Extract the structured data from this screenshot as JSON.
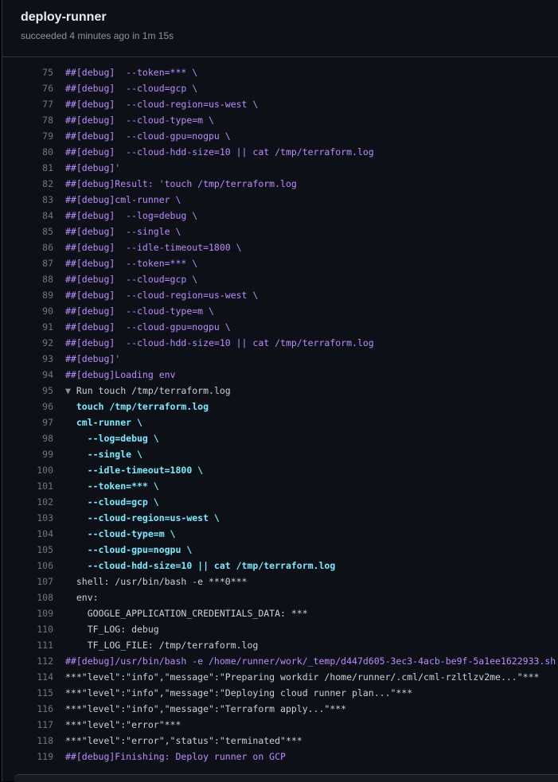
{
  "header": {
    "title": "deploy-runner",
    "subtitle": "succeeded 4 minutes ago in 1m 15s"
  },
  "log_lines": [
    {
      "n": "75",
      "text": "##[debug]  --token=*** \\",
      "kind": "debug"
    },
    {
      "n": "76",
      "text": "##[debug]  --cloud=gcp \\",
      "kind": "debug"
    },
    {
      "n": "77",
      "text": "##[debug]  --cloud-region=us-west \\",
      "kind": "debug"
    },
    {
      "n": "78",
      "text": "##[debug]  --cloud-type=m \\",
      "kind": "debug"
    },
    {
      "n": "79",
      "text": "##[debug]  --cloud-gpu=nogpu \\",
      "kind": "debug"
    },
    {
      "n": "80",
      "text": "##[debug]  --cloud-hdd-size=10 || cat /tmp/terraform.log",
      "kind": "debug"
    },
    {
      "n": "81",
      "text": "##[debug]'",
      "kind": "debug"
    },
    {
      "n": "82",
      "text": "##[debug]Result: 'touch /tmp/terraform.log",
      "kind": "debug"
    },
    {
      "n": "83",
      "text": "##[debug]cml-runner \\",
      "kind": "debug"
    },
    {
      "n": "84",
      "text": "##[debug]  --log=debug \\",
      "kind": "debug"
    },
    {
      "n": "85",
      "text": "##[debug]  --single \\",
      "kind": "debug"
    },
    {
      "n": "86",
      "text": "##[debug]  --idle-timeout=1800 \\",
      "kind": "debug"
    },
    {
      "n": "87",
      "text": "##[debug]  --token=*** \\",
      "kind": "debug"
    },
    {
      "n": "88",
      "text": "##[debug]  --cloud=gcp \\",
      "kind": "debug"
    },
    {
      "n": "89",
      "text": "##[debug]  --cloud-region=us-west \\",
      "kind": "debug"
    },
    {
      "n": "90",
      "text": "##[debug]  --cloud-type=m \\",
      "kind": "debug"
    },
    {
      "n": "91",
      "text": "##[debug]  --cloud-gpu=nogpu \\",
      "kind": "debug"
    },
    {
      "n": "92",
      "text": "##[debug]  --cloud-hdd-size=10 || cat /tmp/terraform.log",
      "kind": "debug"
    },
    {
      "n": "93",
      "text": "##[debug]'",
      "kind": "debug"
    },
    {
      "n": "94",
      "text": "##[debug]Loading env",
      "kind": "debug"
    },
    {
      "n": "95",
      "text": "Run touch /tmp/terraform.log",
      "kind": "group",
      "caret": "▼"
    },
    {
      "n": "96",
      "text": "  touch /tmp/terraform.log",
      "kind": "cmd"
    },
    {
      "n": "97",
      "text": "  cml-runner \\",
      "kind": "cmd"
    },
    {
      "n": "98",
      "text": "    --log=debug \\",
      "kind": "cmd"
    },
    {
      "n": "99",
      "text": "    --single \\",
      "kind": "cmd"
    },
    {
      "n": "100",
      "text": "    --idle-timeout=1800 \\",
      "kind": "cmd"
    },
    {
      "n": "101",
      "text": "    --token=*** \\",
      "kind": "cmd"
    },
    {
      "n": "102",
      "text": "    --cloud=gcp \\",
      "kind": "cmd"
    },
    {
      "n": "103",
      "text": "    --cloud-region=us-west \\",
      "kind": "cmd"
    },
    {
      "n": "104",
      "text": "    --cloud-type=m \\",
      "kind": "cmd"
    },
    {
      "n": "105",
      "text": "    --cloud-gpu=nogpu \\",
      "kind": "cmd"
    },
    {
      "n": "106",
      "text": "    --cloud-hdd-size=10 || cat /tmp/terraform.log",
      "kind": "cmd"
    },
    {
      "n": "107",
      "text": "  shell: /usr/bin/bash -e ***0***",
      "kind": "plain"
    },
    {
      "n": "108",
      "text": "  env:",
      "kind": "plain"
    },
    {
      "n": "109",
      "text": "    GOOGLE_APPLICATION_CREDENTIALS_DATA: ***",
      "kind": "plain"
    },
    {
      "n": "110",
      "text": "    TF_LOG: debug",
      "kind": "plain"
    },
    {
      "n": "111",
      "text": "    TF_LOG_FILE: /tmp/terraform.log",
      "kind": "plain"
    },
    {
      "n": "112",
      "text": "##[debug]/usr/bin/bash -e /home/runner/work/_temp/d447d605-3ec3-4acb-be9f-5a1ee1622933.sh",
      "kind": "debug"
    },
    {
      "n": "114",
      "text": "***\"level\":\"info\",\"message\":\"Preparing workdir /home/runner/.cml/cml-rzltlzv2me...\"***",
      "kind": "plain"
    },
    {
      "n": "115",
      "text": "***\"level\":\"info\",\"message\":\"Deploying cloud runner plan...\"***",
      "kind": "plain"
    },
    {
      "n": "116",
      "text": "***\"level\":\"info\",\"message\":\"Terraform apply...\"***",
      "kind": "plain"
    },
    {
      "n": "117",
      "text": "***\"level\":\"error\"***",
      "kind": "plain"
    },
    {
      "n": "118",
      "text": "***\"level\":\"error\",\"status\":\"terminated\"***",
      "kind": "plain"
    },
    {
      "n": "119",
      "text": "##[debug]Finishing: Deploy runner on GCP",
      "kind": "debug"
    }
  ],
  "colors": {
    "debug": "#bc8cff",
    "command": "#7ee8ff",
    "line_number": "#6e7681",
    "background": "#0d1117"
  }
}
